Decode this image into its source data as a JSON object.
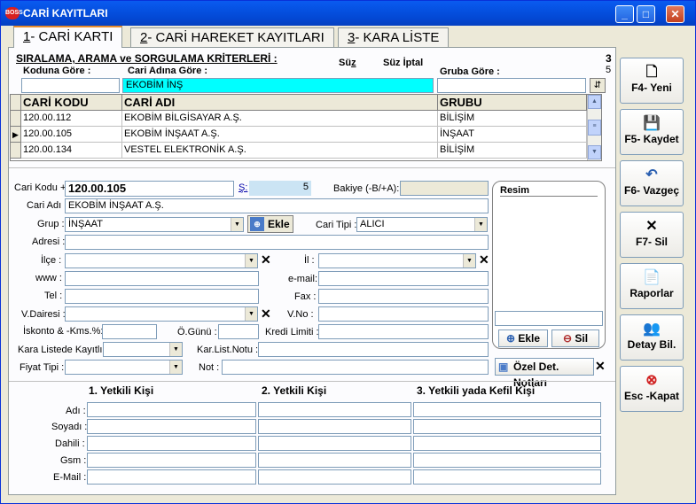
{
  "window": {
    "title": "CARİ KAYITLARI",
    "icon_text": "BOSS"
  },
  "tabs": [
    {
      "num": "1",
      "label": "- CARİ KARTI"
    },
    {
      "num": "2",
      "label": "- CARİ HAREKET KAYITLARI"
    },
    {
      "num": "3",
      "label": "- KARA LİSTE"
    }
  ],
  "search": {
    "section_title": "SIRALAMA, ARAMA ve SORGULAMA KRİTERLERİ :",
    "code_label": "Koduna Göre :",
    "name_label": "Cari Adına Göre :",
    "filter_label": "Süz",
    "filter_cancel_label": "Süz İptal",
    "group_label": "Gruba Göre :",
    "count_top": "3",
    "count_bottom": "5",
    "code_value": "",
    "name_value": "EKOBİM İNŞ",
    "group_value": ""
  },
  "grid": {
    "columns": [
      "CARİ KODU",
      "CARİ ADI",
      "GRUBU"
    ],
    "rows": [
      {
        "code": "120.00.112",
        "name": "EKOBİM BİLGİSAYAR A.Ş.",
        "group": "BİLİŞİM",
        "current": ""
      },
      {
        "code": "120.00.105",
        "name": "EKOBİM İNŞAAT A.Ş.",
        "group": "İNŞAAT",
        "current": "▶"
      },
      {
        "code": "120.00.134",
        "name": "VESTEL ELEKTRONİK A.Ş.",
        "group": "BİLİŞİM",
        "current": ""
      }
    ]
  },
  "form": {
    "cari_kodu_label": "Cari Kodu +",
    "cari_kodu": "120.00.105",
    "s_label": "Ş:",
    "s_value": "5",
    "bakiye_label": "Bakiye (-B/+A):",
    "bakiye": "",
    "cari_adi_label": "Cari Adı :",
    "cari_adi": "EKOBİM İNŞAAT A.Ş.",
    "grup_label": "Grup :",
    "grup": "İNŞAAT",
    "ekle_label": "Ekle",
    "cari_tipi_label": "Cari Tipi :",
    "cari_tipi": "ALICI",
    "adres_label": "Adresi :",
    "ilce_label": "İlçe :",
    "il_label": "İl :",
    "www_label": "www :",
    "email_label": "e-mail:",
    "tel_label": "Tel :",
    "fax_label": "Fax :",
    "vdairesi_label": "V.Dairesi :",
    "vno_label": "V.No :",
    "iskonto_label": "İskonto & -Kms.%:",
    "ogunu_label": "Ö.Günü :",
    "kredi_label": "Kredi Limiti :",
    "kara_liste_label": "Kara Listede Kayıtlı :",
    "kar_list_notu_label": "Kar.List.Notu :",
    "fiyat_tipi_label": "Fiyat Tipi :",
    "not_label": "Not :"
  },
  "resim": {
    "title": "Resim",
    "ekle": "Ekle",
    "sil": "Sil"
  },
  "ozel_det": "Özel Det. Notları",
  "yetkili": {
    "headers": [
      "1. Yetkili Kişi",
      "2. Yetkili Kişi",
      "3. Yetkili yada Kefil Kişi"
    ],
    "rows": [
      "Adı :",
      "Soyadı :",
      "Dahili :",
      "Gsm :",
      "E-Mail :"
    ]
  },
  "actions": [
    {
      "label": "F4- Yeni",
      "icon": "new-document-icon",
      "glyph": "🗋"
    },
    {
      "label": "F5- Kaydet",
      "icon": "save-icon",
      "glyph": "💾"
    },
    {
      "label": "F6- Vazgeç",
      "icon": "undo-icon",
      "glyph": "↶"
    },
    {
      "label": "F7- Sil",
      "icon": "delete-x-icon",
      "glyph": "✕"
    },
    {
      "label": "Raporlar",
      "icon": "report-icon",
      "glyph": "📄"
    },
    {
      "label": "Detay Bil.",
      "icon": "detail-info-icon",
      "glyph": "👥"
    },
    {
      "label": "Esc -Kapat",
      "icon": "close-circle-icon",
      "glyph": "⊗"
    }
  ]
}
